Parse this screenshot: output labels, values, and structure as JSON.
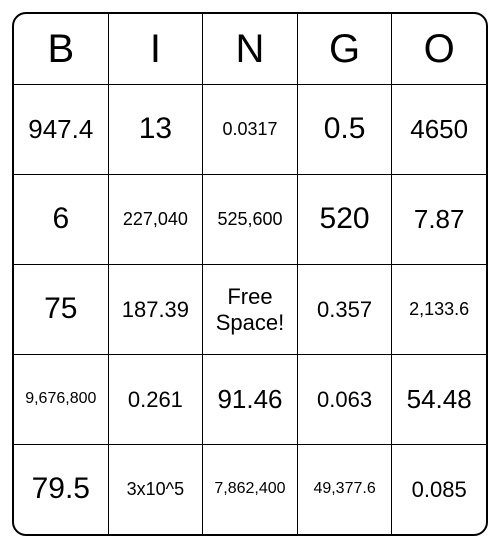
{
  "headers": [
    "B",
    "I",
    "N",
    "G",
    "O"
  ],
  "cells": [
    [
      "947.4",
      "13",
      "0.0317",
      "0.5",
      "4650"
    ],
    [
      "6",
      "227,040",
      "525,600",
      "520",
      "7.87"
    ],
    [
      "75",
      "187.39",
      "Free Space!",
      "0.357",
      "2,133.6"
    ],
    [
      "9,676,800",
      "0.261",
      "91.46",
      "0.063",
      "54.48"
    ],
    [
      "79.5",
      "3x10^5",
      "7,862,400",
      "49,377.6",
      "0.085"
    ]
  ]
}
